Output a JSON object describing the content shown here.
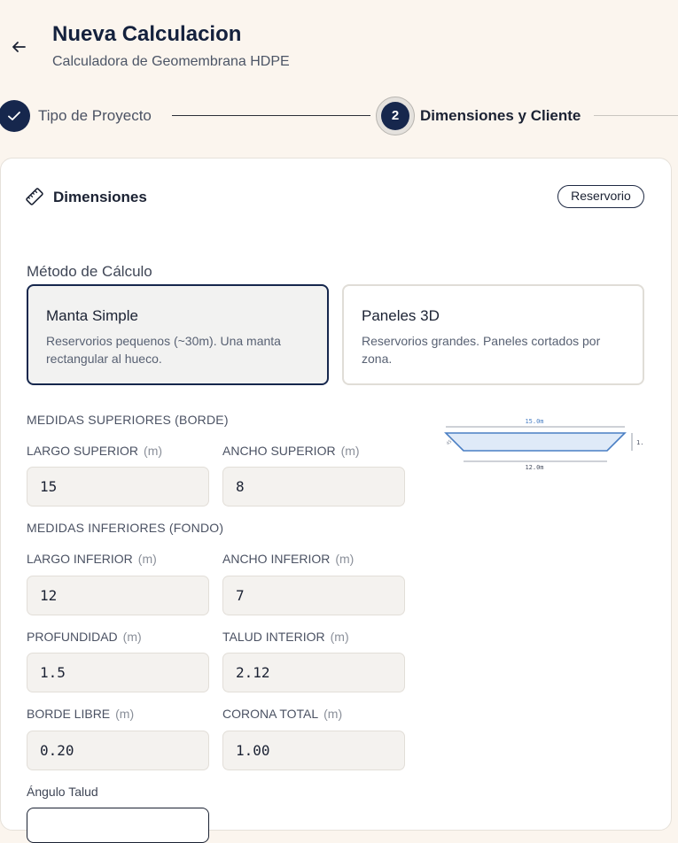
{
  "header": {
    "title": "Nueva Calculacion",
    "subtitle": "Calculadora de Geomembrana HDPE"
  },
  "stepper": {
    "steps": [
      {
        "label": "Tipo de Proyecto",
        "status": "done"
      },
      {
        "number": "2",
        "label": "Dimensiones y Cliente",
        "status": "active"
      }
    ]
  },
  "card": {
    "title": "Dimensiones",
    "badge": "Reservorio",
    "method_label": "Método de Cálculo",
    "options": [
      {
        "title": "Manta Simple",
        "desc": "Reservorios pequenos (~30m). Una manta rectangular al hueco.",
        "selected": true
      },
      {
        "title": "Paneles 3D",
        "desc": "Reservorios grandes. Paneles cortados por zona.",
        "selected": false
      }
    ],
    "sections": {
      "top": "MEDIDAS SUPERIORES (BORDE)",
      "bottom": "MEDIDAS INFERIORES (FONDO)"
    },
    "fields": {
      "largo_superior": {
        "label": "LARGO SUPERIOR",
        "unit": "(m)",
        "value": "15"
      },
      "ancho_superior": {
        "label": "ANCHO SUPERIOR",
        "unit": "(m)",
        "value": "8"
      },
      "largo_inferior": {
        "label": "LARGO INFERIOR",
        "unit": "(m)",
        "value": "12"
      },
      "ancho_inferior": {
        "label": "ANCHO INFERIOR",
        "unit": "(m)",
        "value": "7"
      },
      "profundidad": {
        "label": "PROFUNDIDAD",
        "unit": "(m)",
        "value": "1.5"
      },
      "talud_interior": {
        "label": "TALUD INTERIOR",
        "unit": "(m)",
        "value": "2.12"
      },
      "borde_libre": {
        "label": "BORDE LIBRE",
        "unit": "(m)",
        "value": "0.20"
      },
      "corona_total": {
        "label": "CORONA TOTAL",
        "unit": "(m)",
        "value": "1.00"
      }
    },
    "angulo_label": "Ángulo Talud",
    "diagram": {
      "top_label": "15.0m",
      "bottom_label": "12.0m",
      "depth_label": "1.",
      "side_label": "45°"
    }
  },
  "colors": {
    "primary": "#16274d",
    "background": "#fbf5ee",
    "diagram_fill": "#dfeaf8",
    "diagram_stroke": "#4a7fc4"
  }
}
